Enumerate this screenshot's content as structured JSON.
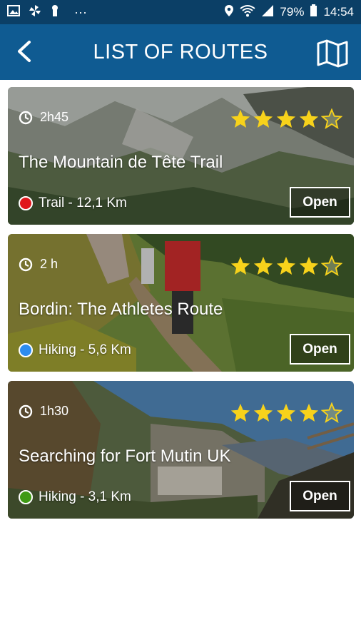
{
  "status_bar": {
    "battery": "79%",
    "time": "14:54",
    "dots": "···"
  },
  "header": {
    "title": "LIST OF ROUTES"
  },
  "routes": [
    {
      "duration": "2h45",
      "title": "The Mountain de Tête Trail",
      "category": "Trail - 12,1 Km",
      "category_color": "#e0161b",
      "rating": 4,
      "open_label": "Open"
    },
    {
      "duration": "2 h",
      "title": "Bordin: The Athletes Route",
      "category": "Hiking - 5,6 Km",
      "category_color": "#2d8cf0",
      "rating": 4,
      "open_label": "Open"
    },
    {
      "duration": "1h30",
      "title": "Searching for Fort Mutin UK",
      "category": "Hiking - 3,1 Km",
      "category_color": "#3f9a14",
      "rating": 4,
      "open_label": "Open"
    }
  ],
  "colors": {
    "status_bar": "#0b3f66",
    "app_bar": "#0f5b92",
    "star": "#f7d21b"
  }
}
